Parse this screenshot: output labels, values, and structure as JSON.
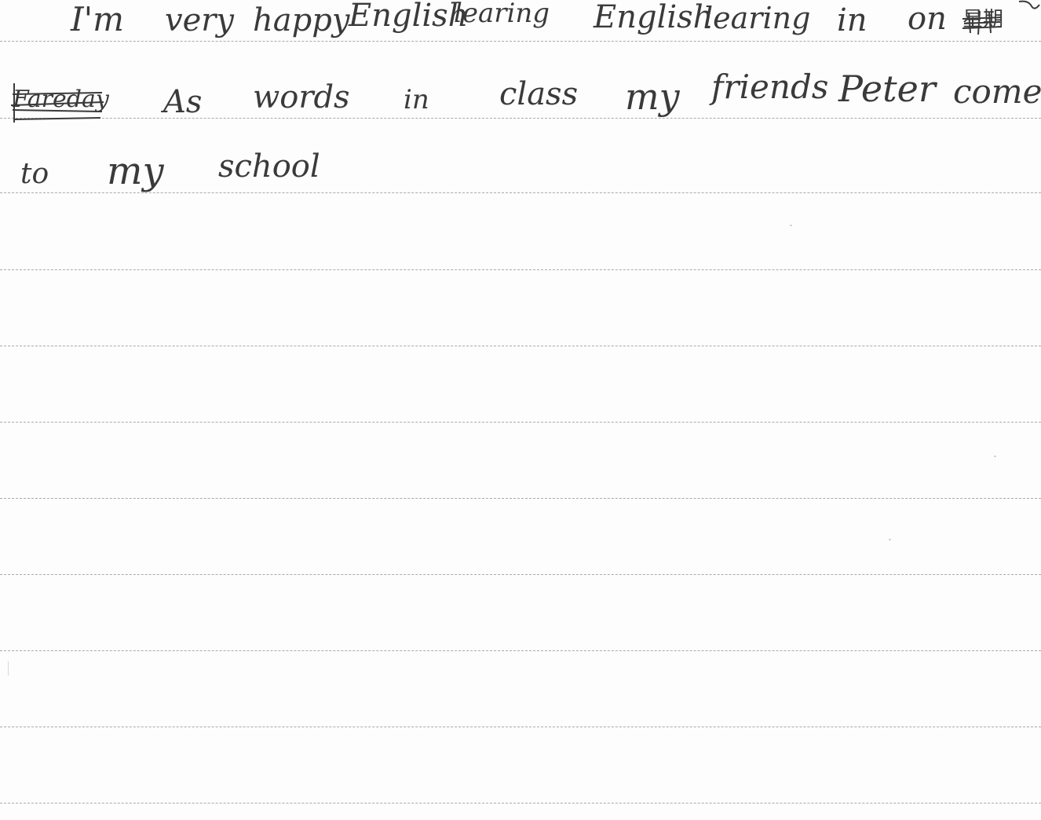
{
  "lines": [
    {
      "words": [
        "I'm",
        "very",
        "happy",
        "English",
        "learing",
        "English",
        "learing",
        "in",
        "on"
      ],
      "crossed_out": [
        "星期"
      ]
    },
    {
      "words": [
        "As",
        "words",
        "in",
        "class",
        "my",
        "friends",
        "Peter",
        "come"
      ],
      "crossed_out": [
        "Fareday"
      ]
    },
    {
      "words": [
        "to",
        "my",
        "school"
      ],
      "crossed_out": []
    }
  ],
  "style": {
    "ink_color": "#3a3a3a",
    "rule_color": "#a9a9a9",
    "paper_color": "#fdfdfd"
  }
}
